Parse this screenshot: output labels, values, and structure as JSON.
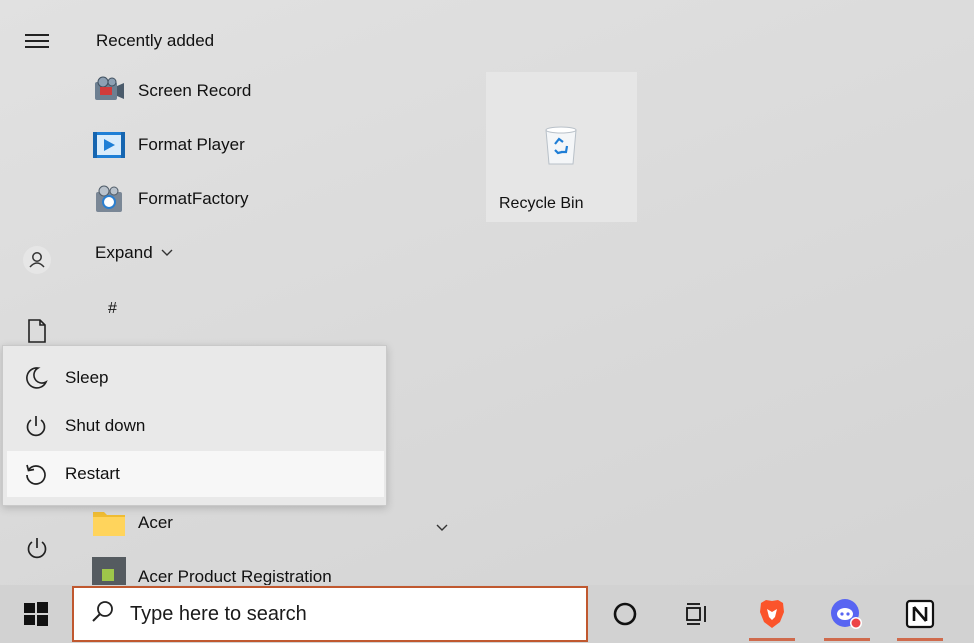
{
  "start_menu": {
    "section_header": "Recently added",
    "recent_apps": [
      {
        "label": "Screen Record",
        "icon": "screen-record-icon"
      },
      {
        "label": "Format Player",
        "icon": "format-player-icon"
      },
      {
        "label": "FormatFactory",
        "icon": "formatfactory-icon"
      }
    ],
    "expand_label": "Expand",
    "letter_header": "#",
    "apps_below": [
      {
        "label": "Acer",
        "icon": "folder-icon"
      },
      {
        "label": "Acer Product Registration",
        "icon": "acer-registration-icon"
      }
    ]
  },
  "tiles": [
    {
      "label": "Recycle Bin",
      "icon": "recycle-bin-icon"
    }
  ],
  "power_menu": {
    "items": [
      {
        "label": "Sleep",
        "icon": "moon-icon"
      },
      {
        "label": "Shut down",
        "icon": "power-icon"
      },
      {
        "label": "Restart",
        "icon": "restart-icon"
      }
    ],
    "highlighted": "Restart"
  },
  "taskbar": {
    "search_placeholder": "Type here to search",
    "search_border_color": "#c0582f",
    "accent_underline_color": "#cf6a4c",
    "icons": [
      "windows-logo-icon",
      "cortana-circle-icon",
      "task-view-icon",
      "brave-browser-icon",
      "discord-icon",
      "notion-icon"
    ]
  }
}
